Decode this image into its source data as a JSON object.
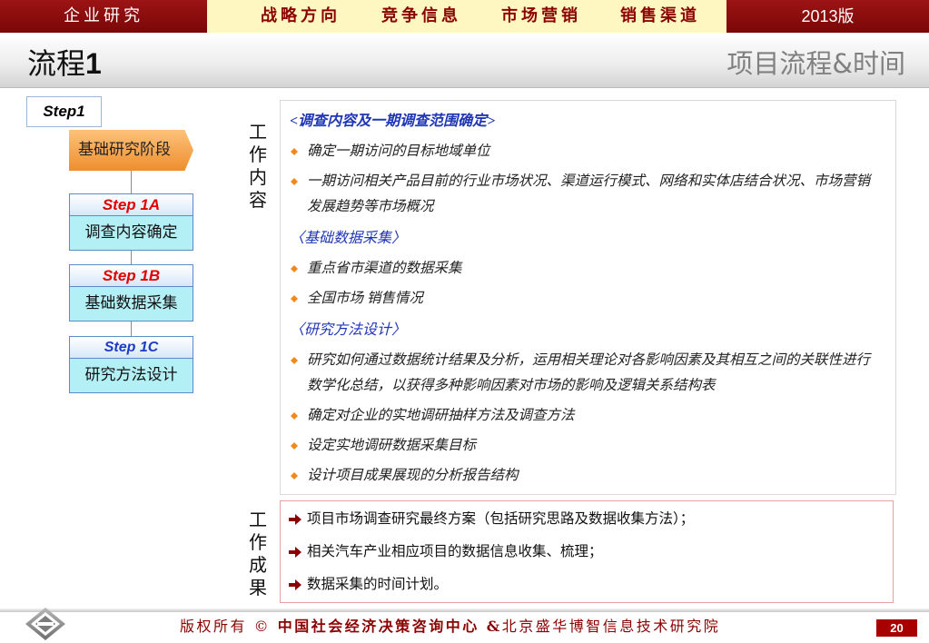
{
  "top_nav": {
    "brand": "企业研究",
    "items": [
      {
        "label": "战略方向"
      },
      {
        "label": "竞争信息"
      },
      {
        "label": "市场营销"
      },
      {
        "label": "销售渠道"
      }
    ],
    "edition": "2013版"
  },
  "header": {
    "title": "流程",
    "title_number": "1",
    "subtitle": "项目流程&时间"
  },
  "flow": {
    "step_label": "Step1",
    "phase_label": "基础研究阶段",
    "steps": [
      {
        "label": "Step 1A",
        "name": "调查内容确定"
      },
      {
        "label": "Step 1B",
        "name": "基础数据采集"
      },
      {
        "label": "Step 1C",
        "name": "研究方法设计"
      }
    ]
  },
  "work_content": {
    "heading": "工作内容",
    "bullet_icon": "diamond-bullet-icon",
    "sections": [
      {
        "title": "<调查内容及一期调查范围确定>",
        "bullets": [
          "确定一期访问的目标地域单位",
          "一期访问相关产品目前的行业市场状况、渠道运行模式、网络和实体店结合状况、市场营销发展趋势等市场概况"
        ]
      },
      {
        "title": "〈基础数据采集〉",
        "bullets": [
          "重点省市渠道的数据采集",
          "全国市场 销售情况"
        ]
      },
      {
        "title": "〈研究方法设计〉",
        "bullets": [
          "研究如何通过数据统计结果及分析，运用相关理论对各影响因素及其相互之间的关联性进行数学化总结，以获得多种影响因素对市场的影响及逻辑关系结构表",
          "确定对企业的实地调研抽样方法及调查方法",
          "设定实地调研数据采集目标",
          "设计项目成果展现的分析报告结构"
        ]
      }
    ]
  },
  "work_results": {
    "heading": "工作成果",
    "item_icon": "arrow-right-icon",
    "items": [
      "项目市场调查研究最终方案（包括研究思路及数据收集方法）；",
      "相关汽车产业相应项目的数据信息收集、梳理；",
      "数据采集的时间计划。"
    ]
  },
  "footer": {
    "copyright_prefix": "版权所有 ©",
    "org_primary": "中国社会经济决策咨询中心 &",
    "org_secondary": "北京盛华博智信息技术研究院",
    "page_number": "20",
    "logo_icon": "diamond-logo-icon"
  },
  "colors": {
    "nav_dark_red": "#8B0A0A",
    "nav_yellow": "#FFF7C2",
    "phase_orange": "#F29A3A",
    "step_label_red": "#E00000",
    "step_label_blue": "#1C3CC4",
    "step_body_cyan": "#B3F0F5",
    "section_title_blue": "#1F36B5",
    "bullet_orange": "#F08A1C",
    "result_arrow": "#8B0000",
    "footer_red": "#8B0000",
    "page_number_bg": "#A80000"
  }
}
